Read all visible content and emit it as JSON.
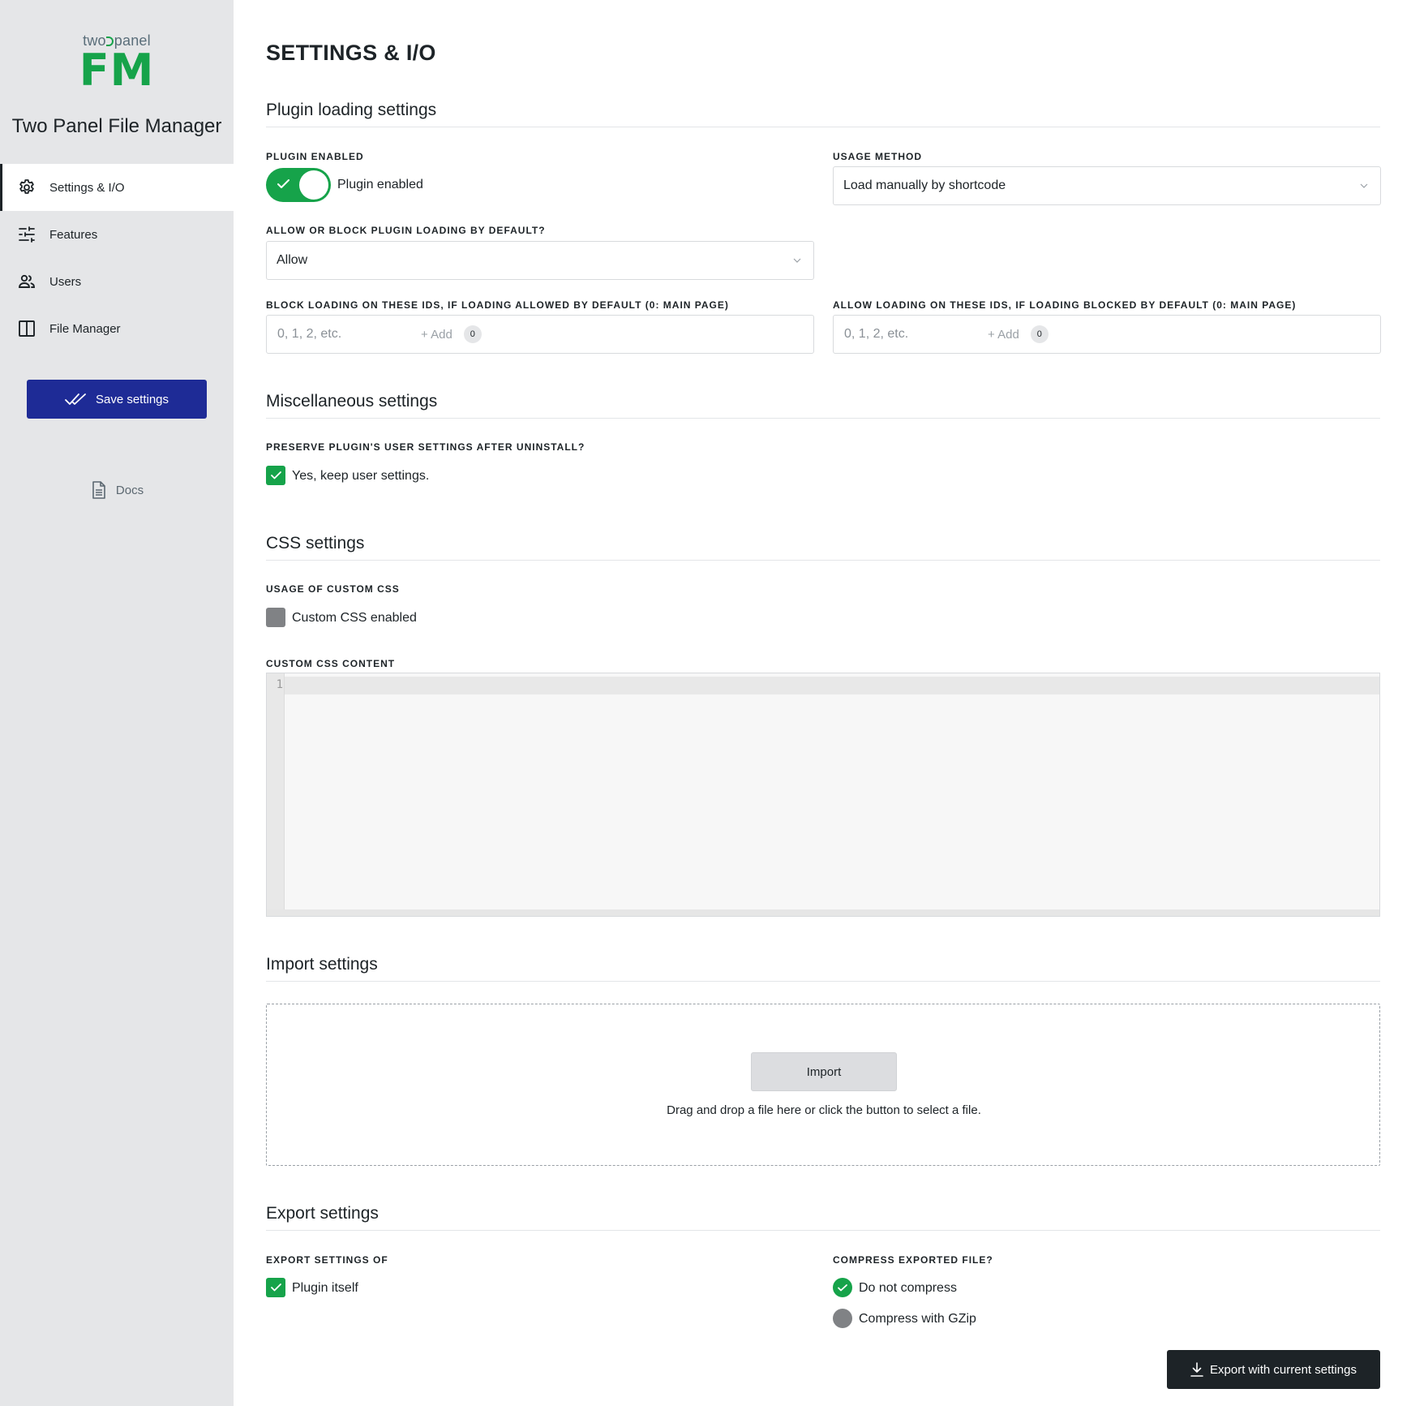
{
  "sidebar": {
    "logo": {
      "small_left": "two",
      "small_right": "panel",
      "big": "FM"
    },
    "app_name": "Two Panel File Manager",
    "nav": [
      {
        "label": "Settings & I/O",
        "icon": "gear-icon",
        "active": true
      },
      {
        "label": "Features",
        "icon": "sliders-icon",
        "active": false
      },
      {
        "label": "Users",
        "icon": "users-icon",
        "active": false
      },
      {
        "label": "File Manager",
        "icon": "columns-icon",
        "active": false
      }
    ],
    "save_label": "Save settings",
    "docs_label": "Docs"
  },
  "main": {
    "title": "SETTINGS & I/O",
    "plugin_loading": {
      "title": "Plugin loading settings",
      "plugin_enabled_label": "PLUGIN ENABLED",
      "plugin_enabled_text": "Plugin enabled",
      "plugin_enabled_on": true,
      "usage_method_label": "USAGE METHOD",
      "usage_method_value": "Load manually by shortcode",
      "default_label": "ALLOW OR BLOCK PLUGIN LOADING BY DEFAULT?",
      "default_value": "Allow",
      "block_ids_label": "BLOCK LOADING ON THESE IDS, IF LOADING ALLOWED BY DEFAULT (0: MAIN PAGE)",
      "block_ids_placeholder": "0, 1, 2, etc.",
      "block_ids_add": "+ Add",
      "block_ids_tag": "0",
      "allow_ids_label": "ALLOW LOADING ON THESE IDS, IF LOADING BLOCKED BY DEFAULT (0: MAIN PAGE)",
      "allow_ids_placeholder": "0, 1, 2, etc.",
      "allow_ids_add": "+ Add",
      "allow_ids_tag": "0"
    },
    "misc": {
      "title": "Miscellaneous settings",
      "preserve_label": "PRESERVE PLUGIN'S USER SETTINGS AFTER UNINSTALL?",
      "preserve_text": "Yes, keep user settings.",
      "preserve_checked": true
    },
    "css": {
      "title": "CSS settings",
      "usage_label": "USAGE OF CUSTOM CSS",
      "usage_text": "Custom CSS enabled",
      "usage_checked": false,
      "content_label": "CUSTOM CSS CONTENT",
      "line_number": "1"
    },
    "import": {
      "title": "Import settings",
      "button": "Import",
      "hint": "Drag and drop a file here or click the button to select a file."
    },
    "export": {
      "title": "Export settings",
      "of_label": "EXPORT SETTINGS OF",
      "plugin_itself": "Plugin itself",
      "plugin_itself_checked": true,
      "compress_label": "COMPRESS EXPORTED FILE?",
      "compress_options": [
        {
          "label": "Do not compress",
          "selected": true
        },
        {
          "label": "Compress with GZip",
          "selected": false
        }
      ],
      "button": "Export with current settings"
    }
  },
  "colors": {
    "accent_green": "#16a34a",
    "save_button_blue": "#1e2b96",
    "export_button_dark": "#1d2327",
    "sidebar_bg": "#e5e6e8"
  }
}
